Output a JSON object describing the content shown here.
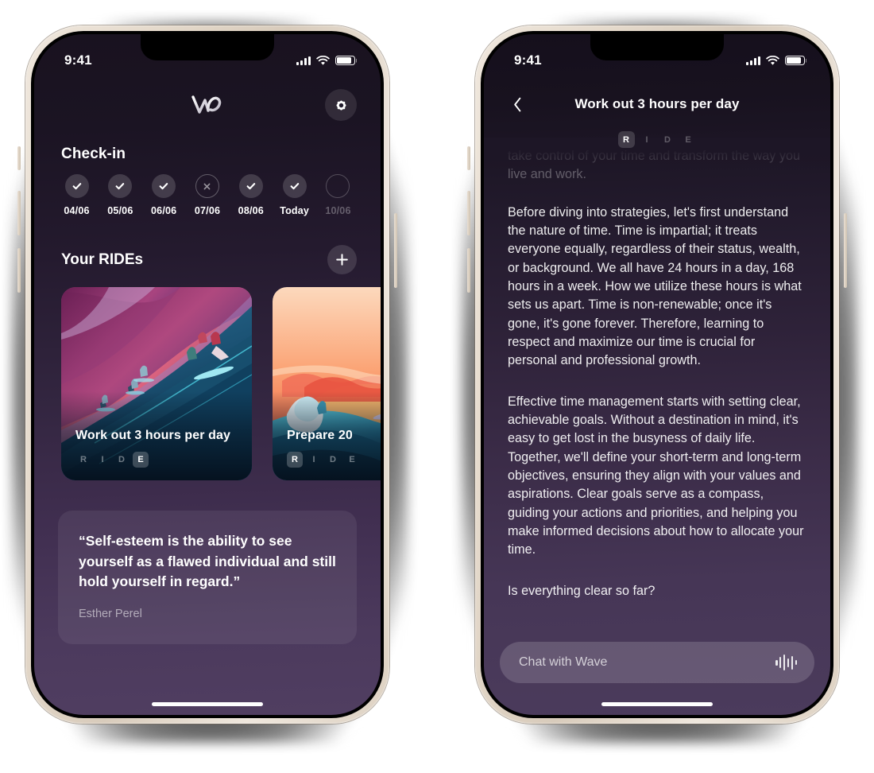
{
  "theme": {
    "frame_color": "#e6dbcd",
    "screen_top_bg": "#19121f",
    "screen_bottom_bg": "#503e61",
    "accent_text": "#ffffff",
    "muted_text": "rgba(255,255,255,0.55)"
  },
  "status_bar": {
    "time": "9:41",
    "cellular_icon": "cellular-bars-icon",
    "wifi_icon": "wifi-icon",
    "battery_icon": "battery-icon"
  },
  "left_screen": {
    "logo_icon": "wave-logo-icon",
    "settings_icon": "gear-icon",
    "checkin": {
      "title": "Check-in",
      "days": [
        {
          "label": "04/06",
          "state": "done",
          "icon": "check-icon"
        },
        {
          "label": "05/06",
          "state": "done",
          "icon": "check-icon"
        },
        {
          "label": "06/06",
          "state": "done",
          "icon": "check-icon"
        },
        {
          "label": "07/06",
          "state": "missed",
          "icon": "x-icon"
        },
        {
          "label": "08/06",
          "state": "done",
          "icon": "check-icon"
        },
        {
          "label": "Today",
          "state": "done",
          "icon": "check-icon"
        },
        {
          "label": "10/06",
          "state": "future",
          "icon": "empty-circle-icon"
        }
      ]
    },
    "rides": {
      "title": "Your RIDEs",
      "add_icon": "plus-icon",
      "cards": [
        {
          "title": "Work out 3 hours per day",
          "steps": [
            "R",
            "I",
            "D",
            "E"
          ],
          "active_step": "E",
          "art": "surfers-big-purple-wave"
        },
        {
          "title": "Prepare 20",
          "steps": [
            "R",
            "I",
            "D",
            "E"
          ],
          "active_step": "R",
          "art": "sunset-surfer-orange-sky"
        }
      ]
    },
    "quote": {
      "text": "“Self-esteem is the ability to see yourself as a flawed individual and still hold yourself in regard.”",
      "author": "Esther Perel"
    },
    "home_indicator": "home-indicator"
  },
  "right_screen": {
    "back_icon": "chevron-left-icon",
    "title": "Work out 3 hours per day",
    "steps": [
      "R",
      "I",
      "D",
      "E"
    ],
    "active_step": "R",
    "article": {
      "faded_paragraph": "take control of your time and transform the way you live and work.",
      "paragraphs": [
        "Before diving into strategies, let's first understand the nature of time. Time is impartial; it treats everyone equally, regardless of their status, wealth, or background. We all have 24 hours in a day, 168 hours in a week. How we utilize these hours is what sets us apart. Time is non-renewable; once it's gone, it's gone forever. Therefore, learning to respect and maximize our time is crucial for personal and professional growth.",
        "Effective time management starts with setting clear, achievable goals. Without a destination in mind, it's easy to get lost in the busyness of daily life. Together, we'll define your short-term and long-term objectives, ensuring they align with your values and aspirations. Clear goals serve as a compass, guiding your actions and priorities, and helping you make informed decisions about how to allocate your time.",
        "Is everything clear so far?"
      ]
    },
    "chat": {
      "placeholder": "Chat with Wave",
      "voice_icon": "waveform-icon"
    },
    "home_indicator": "home-indicator"
  }
}
